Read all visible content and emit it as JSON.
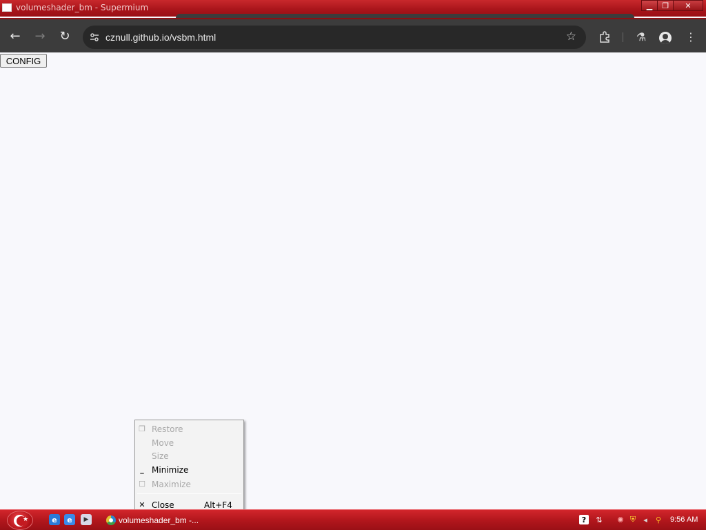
{
  "window": {
    "title": "volumeshader_bm - Supermium",
    "icon": "window-icon",
    "controls": {
      "minimize": "minimize-icon",
      "maximize": "restore-icon",
      "close": "close-icon"
    }
  },
  "browser": {
    "url": "cznull.github.io/vsbm.html",
    "icons": {
      "back": "←",
      "forward": "→",
      "reload": "↻",
      "site_info": "⚙",
      "bookmark": "☆",
      "extensions": "⧉",
      "labs": "⚗",
      "menu": "⋮"
    }
  },
  "page": {
    "config_button": "CONFIG"
  },
  "context_menu": {
    "items": [
      {
        "label": "Restore",
        "icon": "❐",
        "enabled": false
      },
      {
        "label": "Move",
        "icon": "",
        "enabled": false
      },
      {
        "label": "Size",
        "icon": "",
        "enabled": false
      },
      {
        "label": "Minimize",
        "icon": "_",
        "enabled": true
      },
      {
        "label": "Maximize",
        "icon": "☐",
        "enabled": false
      },
      {
        "label": "Close",
        "icon": "✕",
        "shortcut": "Alt+F4",
        "enabled": true
      }
    ]
  },
  "taskbar": {
    "task_label": "volumeshader_bm -...",
    "clock": "9:56 AM",
    "quick_launch": [
      {
        "name": "internet-explorer-icon",
        "glyph": "e",
        "color": "#2a7ad8"
      },
      {
        "name": "ie-alt-icon",
        "glyph": "e",
        "color": "#3a8ae8"
      },
      {
        "name": "media-player-icon",
        "glyph": "▶",
        "color": "#d8d8e8"
      }
    ],
    "tray": {
      "help": "?",
      "network": "⇅",
      "sync": "✺",
      "security": "⛨",
      "volume": "◂",
      "search": "⚲"
    }
  }
}
